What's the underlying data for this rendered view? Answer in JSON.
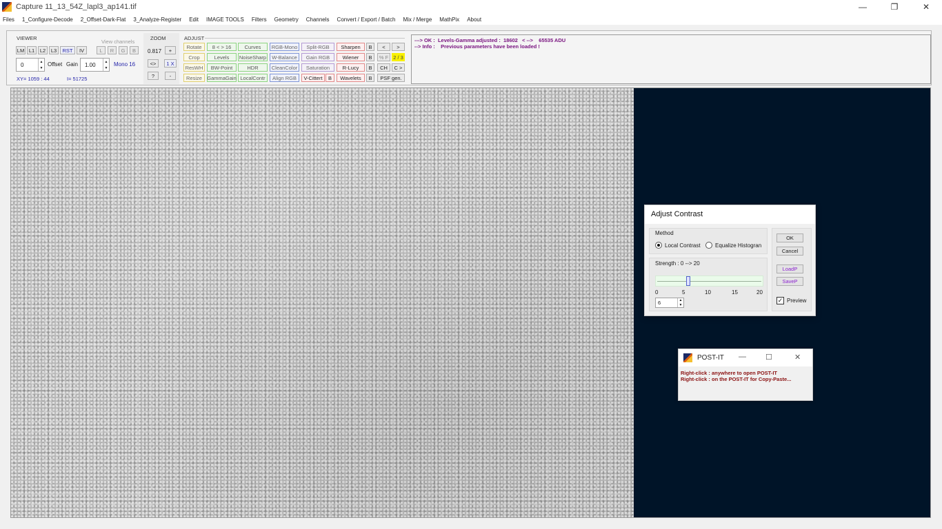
{
  "window": {
    "title": "Capture 11_13_54Z_lapl3_ap141.tif",
    "controls": [
      "—",
      "❐",
      "✕"
    ]
  },
  "menu": [
    "Files",
    "1_Configure-Decode",
    "2_Offset-Dark-Flat",
    "3_Analyze-Register",
    "Edit",
    "IMAGE TOOLS",
    "Filters",
    "Geometry",
    "Channels",
    "Convert / Export / Batch",
    "Mix / Merge",
    "MathPix",
    "About"
  ],
  "viewer": {
    "title": "VIEWER",
    "view_channels_label": "View channels",
    "buttons": [
      "LM",
      "L1",
      "L2",
      "L3",
      "RST",
      "IV"
    ],
    "channels": [
      "L",
      "R",
      "G",
      "B"
    ],
    "offset_value": "0",
    "offset_label": "Offset",
    "gain_label": "Gain",
    "gain_value": "1.00",
    "mode": "Mono 16",
    "xy": "XY=  1059 : 44",
    "intensity": "I=  51725"
  },
  "zoom": {
    "title": "ZOOM",
    "value": "0.817",
    "plus": "+",
    "fit": "<>",
    "one": "1 X",
    "help": "?",
    "minus": "-"
  },
  "adjust": {
    "title": "ADJUST",
    "col1": [
      "Rotate",
      "Crop",
      "ResWH",
      "Resize"
    ],
    "col2": [
      "8 < > 16",
      "Levels",
      "BW-Point",
      "GammaGain"
    ],
    "col3": [
      "Curves",
      "NoiseSharp",
      "HDR",
      "LocalContr"
    ],
    "col4": [
      "RGB-Mono",
      "W-Balance",
      "CleanColor",
      "Align RGB"
    ],
    "col5": [
      "Split-RGB",
      "Gain RGB",
      "Saturation",
      "V-Cittert"
    ],
    "col5_b": "B",
    "col6": [
      "Sharpen",
      "Wiener",
      "R-Lucy",
      "Wavelets"
    ],
    "b_label": "B",
    "prev": "<",
    "next": ">",
    "pct": "% F",
    "page": "2 / 3",
    "ch": "CH",
    "c_next": "C >",
    "psf": "PSF gen."
  },
  "messages": [
    "---> OK :  Levels-Gamma adjusted :  18602   < -->    65535 ADU",
    "--> Info :    Previous parameters have been loaded !"
  ],
  "dialog": {
    "title": "Adjust Contrast",
    "method_label": "Method",
    "option_local": "Local Contrast",
    "option_equalize": "Equalize Histogran",
    "selected": "Local Contrast",
    "strength_label": "Strength :  0 --> 20",
    "slider_value": 6,
    "slider_min": 0,
    "slider_max": 20,
    "ticks": [
      "0",
      "5",
      "10",
      "15",
      "20"
    ],
    "spin_value": "6",
    "ok": "OK",
    "cancel": "Cancel",
    "loadp": "LoadP",
    "savep": "SaveP",
    "preview_label": "Preview",
    "preview_checked": true
  },
  "postit": {
    "title": "POST-IT",
    "lines": [
      "Right-click :  anywhere to open POST-IT",
      "Right-click :  on the POST-IT for Copy-Paste..."
    ]
  }
}
